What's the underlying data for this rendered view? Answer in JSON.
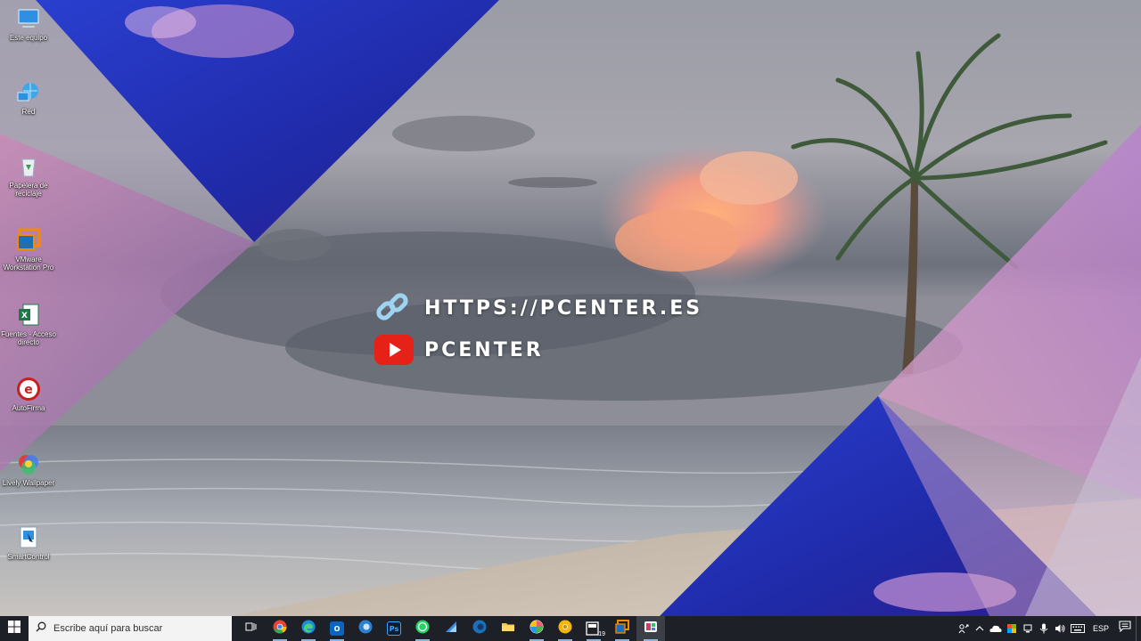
{
  "desktop": {
    "icons": [
      {
        "label": "Este equipo",
        "icon": "computer-icon"
      },
      {
        "label": "Red",
        "icon": "network-icon"
      },
      {
        "label": "Papelera de reciclaje",
        "icon": "recycle-bin-icon"
      },
      {
        "label": "VMware Workstation Pro",
        "icon": "vmware-icon"
      },
      {
        "label": "Fuentes - Acceso directo",
        "icon": "excel-icon"
      },
      {
        "label": "AutoFirma",
        "icon": "autofirma-icon"
      },
      {
        "label": "Lively Wallpaper",
        "icon": "lively-icon"
      },
      {
        "label": "SmartControl",
        "icon": "smartcontrol-icon"
      }
    ]
  },
  "branding": {
    "url_text": "HTTPS://PCENTER.ES",
    "channel_text": "PCENTER",
    "url_icon": "link-icon",
    "channel_icon": "youtube-icon"
  },
  "taskbar": {
    "search_placeholder": "Escribe aquí para buscar",
    "apps": [
      {
        "name": "task-view",
        "glyph": "⧉",
        "color": "#1d2027"
      },
      {
        "name": "chrome",
        "glyph": "",
        "color": "#ea4335"
      },
      {
        "name": "edge",
        "glyph": "",
        "color": "#1b8fd6"
      },
      {
        "name": "outlook",
        "glyph": "O",
        "color": "#0a64c2"
      },
      {
        "name": "edge-beta",
        "glyph": "",
        "color": "#2c7fd1"
      },
      {
        "name": "photoshop",
        "glyph": "Ps",
        "color": "#0b1b33"
      },
      {
        "name": "whatsapp",
        "glyph": "",
        "color": "#25d366"
      },
      {
        "name": "sketch-app",
        "glyph": "",
        "color": "#3b8ee0"
      },
      {
        "name": "edge-dev",
        "glyph": "",
        "color": "#1d6fb8"
      },
      {
        "name": "file-explorer",
        "glyph": "",
        "color": "#f4c542"
      },
      {
        "name": "pinwheel-app",
        "glyph": "",
        "color": "#e85d75"
      },
      {
        "name": "chrome-canary",
        "glyph": "",
        "color": "#f2b705"
      },
      {
        "name": "calendar-app",
        "glyph": "19",
        "color": "#2a2d33"
      },
      {
        "name": "vmware",
        "glyph": "",
        "color": "#f38b00"
      },
      {
        "name": "snip-app",
        "glyph": "",
        "color": "#d63b6e"
      }
    ],
    "language": "ESP"
  },
  "colors": {
    "taskbar_bg": "#1d2027",
    "search_bg": "#f3f3f3",
    "youtube_red": "#e62117",
    "link_blue": "#9fd3f2"
  }
}
